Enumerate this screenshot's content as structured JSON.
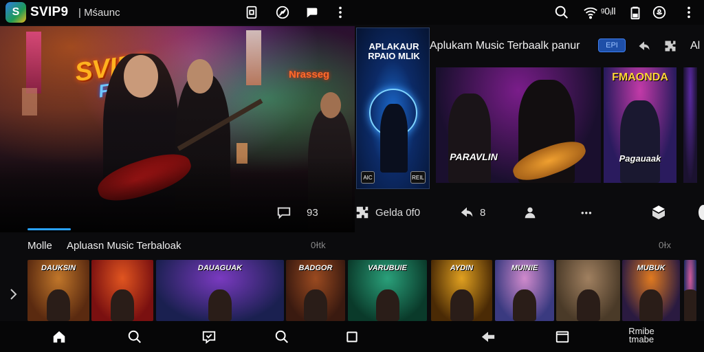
{
  "app": {
    "logo_glyph": "S",
    "title": "SVIP9",
    "subtitle": "| Mśaunc"
  },
  "topbar": {
    "icons": [
      "sim-card-icon",
      "no-signal-icon",
      "chat-bubble-icon",
      "more-vertical-icon"
    ],
    "right_icons": [
      "search-icon",
      "wifi-icon",
      "battery-icon",
      "at-sign-icon",
      "more-vertical-icon"
    ],
    "status_text": "ᵍ0ᵢll"
  },
  "hero": {
    "logo_line1": "SVIPP",
    "logo_line2": "FRAVI",
    "neon_sign": "Nrasseg"
  },
  "poster": {
    "title": "APLAKAUR RPAIO MLIK",
    "badge_left": "AIC",
    "badge_right": "REIL"
  },
  "section1": {
    "title": "Aplukam Music Terbaalk panur",
    "badge": "EPI",
    "more": "Al"
  },
  "large_cards": [
    {
      "caption": "PARAVLIN",
      "color_a": "#1a0f2e",
      "color_b": "#7a1d8a"
    },
    {
      "caption": "",
      "color_a": "#3b1a0a",
      "color_b": "#d86a12"
    },
    {
      "caption": "FMAONDA",
      "subcaption": "Pagauaak",
      "color_a": "#2a1b5e",
      "color_b": "#c23aa8"
    },
    {
      "caption": "",
      "color_a": "#1b1230",
      "color_b": "#5a2aa0"
    }
  ],
  "actions": [
    {
      "icon": "comment-icon",
      "label": "93"
    },
    {
      "icon": "puzzle-icon",
      "label": "Gelda 0f0"
    },
    {
      "icon": "share-icon",
      "label": "8"
    },
    {
      "icon": "person-icon",
      "label": ""
    },
    {
      "icon": "more-horizontal-icon",
      "label": "•••"
    },
    {
      "icon": "box-icon",
      "label": ""
    }
  ],
  "section2": {
    "tab_active": "Molle",
    "title": "Apluasn Music Terbaloak",
    "count_left": "0ɫtk",
    "count_right": "0ɫx"
  },
  "thumbnails": [
    {
      "title": "DAUKSIN",
      "color_a": "#5a2a10",
      "color_b": "#c0762a"
    },
    {
      "title": "",
      "color_a": "#7a1010",
      "color_b": "#e05520"
    },
    {
      "title": "DAUAGUAK",
      "color_a": "#1a2050",
      "color_b": "#7a3ac0"
    },
    {
      "title": "BADGOR",
      "color_a": "#3a1a10",
      "color_b": "#9a4a20"
    },
    {
      "title": "VARUBUIE",
      "color_a": "#0a3a2a",
      "color_b": "#2aa07a"
    },
    {
      "title": "AYDIN",
      "color_a": "#4a2a05",
      "color_b": "#e0a020"
    },
    {
      "title": "MUINIE",
      "color_a": "#3a3a80",
      "color_b": "#d08acc"
    },
    {
      "title": "",
      "color_a": "#4a3a28",
      "color_b": "#a08060"
    },
    {
      "title": "MUBUK",
      "color_a": "#2a1a40",
      "color_b": "#e07a20"
    },
    {
      "title": "",
      "color_a": "#1a2a60",
      "color_b": "#d05a9a"
    }
  ],
  "bottom_nav": {
    "items": [
      "home-icon",
      "search-icon",
      "chat-icon",
      "search-icon",
      "square-icon",
      "back-icon",
      "tablet-icon"
    ],
    "label": "Rmibe tmabe"
  }
}
